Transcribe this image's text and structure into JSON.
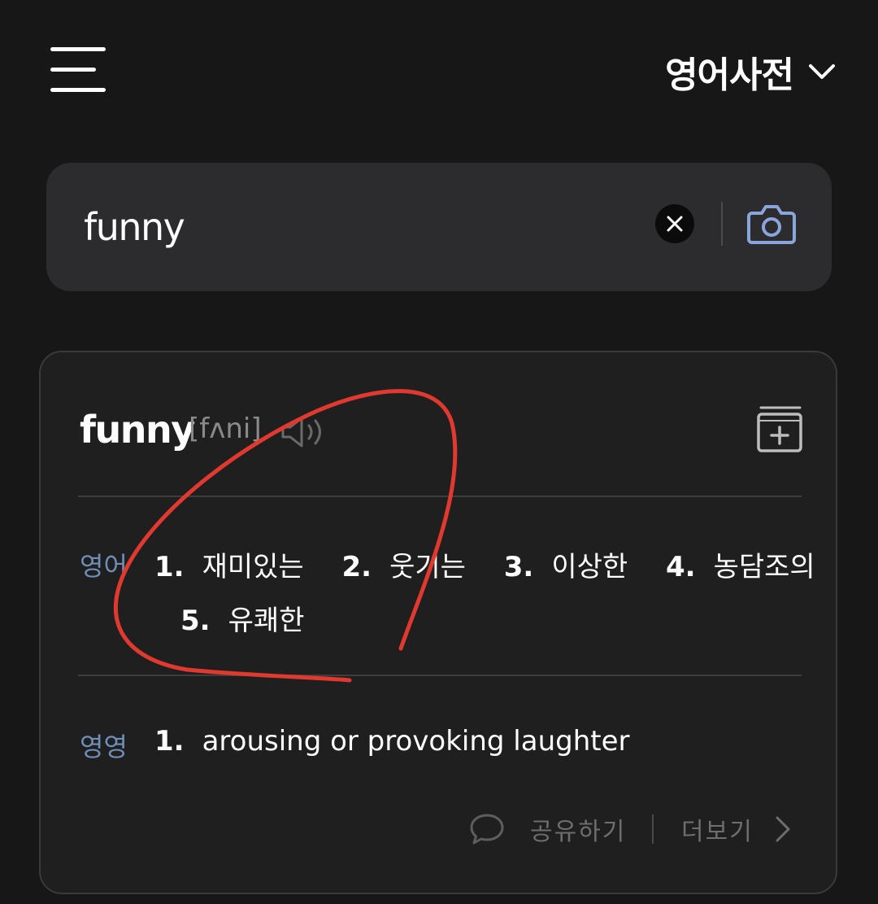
{
  "header": {
    "dictionary_title": "영어사전",
    "menu_icon": "hamburger-menu-icon",
    "dropdown_icon": "chevron-down-icon"
  },
  "search": {
    "query": "funny",
    "placeholder": "",
    "clear_icon": "close-icon",
    "camera_icon": "camera-icon"
  },
  "entry": {
    "word": "funny",
    "pronunciation": "[fʌni]",
    "speaker_icon": "speaker-icon",
    "wordbook_icon": "add-to-wordbook-icon",
    "ko_section": {
      "label": "영어",
      "meanings": [
        {
          "num": "1.",
          "text": "재미있는"
        },
        {
          "num": "2.",
          "text": "웃기는"
        },
        {
          "num": "3.",
          "text": "이상한"
        },
        {
          "num": "4.",
          "text": "농담조의"
        },
        {
          "num": "5.",
          "text": "유쾌한"
        }
      ]
    },
    "en_section": {
      "label": "영영",
      "meanings": [
        {
          "num": "1.",
          "text": "arousing or provoking laughter"
        }
      ]
    },
    "actions": {
      "share_label": "공유하기",
      "share_icon": "speech-bubble-icon",
      "more_label": "더보기",
      "more_icon": "chevron-right-icon"
    }
  },
  "colors": {
    "background": "#171717",
    "search_box": "#2c2c2e",
    "card": "#1f1f1f",
    "accent_blue": "#6f8fb8",
    "camera_blue": "#8aa4dc",
    "annotation_red": "#e0392f"
  }
}
